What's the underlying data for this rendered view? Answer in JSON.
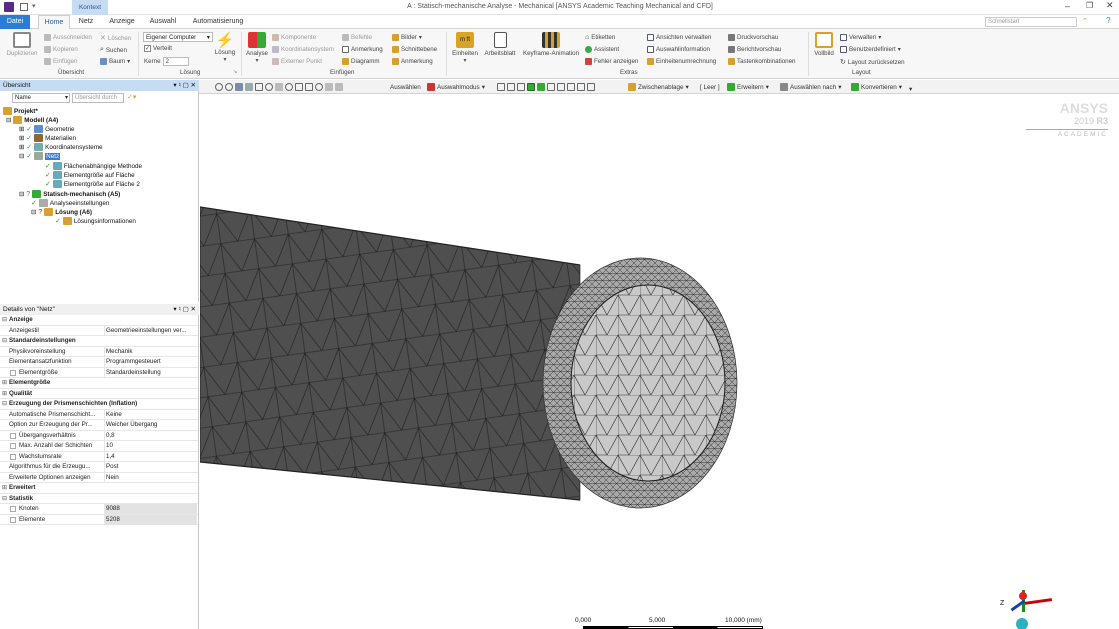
{
  "window": {
    "title": "A : Statisch-mechanische Analyse - Mechanical [ANSYS Academic Teaching Mechanical and CFD]",
    "context_tab": "Kontext",
    "search_placeholder": "Schnellstart"
  },
  "tabs": [
    "Datei",
    "Home",
    "Netz",
    "Anzeige",
    "Auswahl",
    "Automatisierung"
  ],
  "ribbon": {
    "duplizieren": "Duplizieren",
    "ausschneiden": "Ausschneiden",
    "kopieren": "Kopieren",
    "einfuegen": "Einfügen",
    "loeschen": "Löschen",
    "suchen": "Suchen",
    "baum": "Baum",
    "group_uebersicht": "Übersicht",
    "computer": "Eigener Computer",
    "verteilt": "Verteilt",
    "kerne_label": "Kerne",
    "kerne_value": "2",
    "loesung": "Lösung",
    "group_loesung": "Lösung",
    "analyse": "Analyse",
    "komponente": "Komponente",
    "koordinatensystem": "Koordinatensystem",
    "externer_punkt": "Externer Punkt",
    "befehle": "Befehle",
    "anmerkung": "Anmerkung",
    "diagramm": "Diagramm",
    "bilder": "Bilder",
    "schnittebene": "Schnittebene",
    "anmerkung2": "Anmerkung",
    "group_einfuegen": "Einfügen",
    "einheiten": "Einheiten",
    "arbeitsblatt": "Arbeitsblatt",
    "keyframe": "Keyframe-Animation",
    "etiketten": "Etiketten",
    "assistent": "Assistent",
    "fehler": "Fehler anzeigen",
    "ansichten": "Ansichten verwalten",
    "auswahlinfo": "Auswahlinformation",
    "einheitenumrechnung": "Einheitenumrechnung",
    "druckvorschau": "Druckvorschau",
    "berichtvorschau": "Berichtvorschau",
    "tastenkomb": "Tastenkombinationen",
    "group_extras": "Extras",
    "vollbild": "Vollbild",
    "verwalten": "Verwalten",
    "benutzerdefiniert": "Benutzerdefiniert",
    "layout_reset": "Layout zurücksetzen",
    "group_layout": "Layout"
  },
  "toolbar": {
    "auswaehlen": "Auswählen",
    "auswahlmodus": "Auswahlmodus",
    "zwischenablage": "Zwischenablage",
    "leer": "[ Leer ]",
    "erweitern": "Erweitern",
    "auswaehlen_nach": "Auswählen nach",
    "konvertieren": "Konvertieren"
  },
  "outline": {
    "title": "Übersicht",
    "filter_label": "Name",
    "filter_placeholder": "Übersicht durch",
    "items": [
      "Projekt*",
      "Modell (A4)",
      "Geometrie",
      "Materialien",
      "Koordinatensysteme",
      "Netz",
      "Flächenabhängige Methode",
      "Elementgröße auf Fläche",
      "Elementgröße auf Fläche 2",
      "Statisch-mechanisch (A5)",
      "Analyseeinstellungen",
      "Lösung (A6)",
      "Lösungsinformationen"
    ]
  },
  "details": {
    "title": "Details von \"Netz\"",
    "rows": [
      {
        "t": "g",
        "k": "Anzeige"
      },
      {
        "t": "r",
        "k": "Anzeigestil",
        "v": "Geometrieeinstellungen ver..."
      },
      {
        "t": "g",
        "k": "Standardeinstellungen"
      },
      {
        "t": "r",
        "k": "Physikvoreinstellung",
        "v": "Mechanik"
      },
      {
        "t": "r",
        "k": "Elementansatzfunktion",
        "v": "Programmgesteuert"
      },
      {
        "t": "c",
        "k": "Elementgröße",
        "v": "Standardeinstellung"
      },
      {
        "t": "g",
        "k": "Elementgröße",
        "c": true
      },
      {
        "t": "g",
        "k": "Qualität",
        "c": true
      },
      {
        "t": "g",
        "k": "Erzeugung der Prismenschichten (Inflation)"
      },
      {
        "t": "r",
        "k": "Automatische Prismenschicht...",
        "v": "Keine"
      },
      {
        "t": "r",
        "k": "Option zur Erzeugung der Pr...",
        "v": "Weicher Übergang"
      },
      {
        "t": "c",
        "k": "Übergangsverhältnis",
        "v": "0,8"
      },
      {
        "t": "c",
        "k": "Max. Anzahl der Schichten",
        "v": "10"
      },
      {
        "t": "c",
        "k": "Wachstumsrate",
        "v": "1,4"
      },
      {
        "t": "r",
        "k": "Algorithmus für die Erzeugu...",
        "v": "Post"
      },
      {
        "t": "r",
        "k": "Erweiterte Optionen anzeigen",
        "v": "Nein"
      },
      {
        "t": "g",
        "k": "Erweitert",
        "c": true
      },
      {
        "t": "g",
        "k": "Statistik"
      },
      {
        "t": "c",
        "k": "Knoten",
        "v": "9088",
        "s": true
      },
      {
        "t": "c",
        "k": "Elemente",
        "v": "5208",
        "s": true
      }
    ]
  },
  "brand": {
    "name": "ANSYS",
    "version": "2019",
    "release": "R3",
    "edition": "ACADEMIC"
  },
  "scale": {
    "l0": "0,000",
    "l1": "5,000",
    "l2": "10,000 (mm)"
  },
  "triad": {
    "z": "Z"
  },
  "colors": {
    "file_tab": "#2b7cd3",
    "panel_header": "#c5dcf3",
    "mesh": "#4a4a4a"
  }
}
